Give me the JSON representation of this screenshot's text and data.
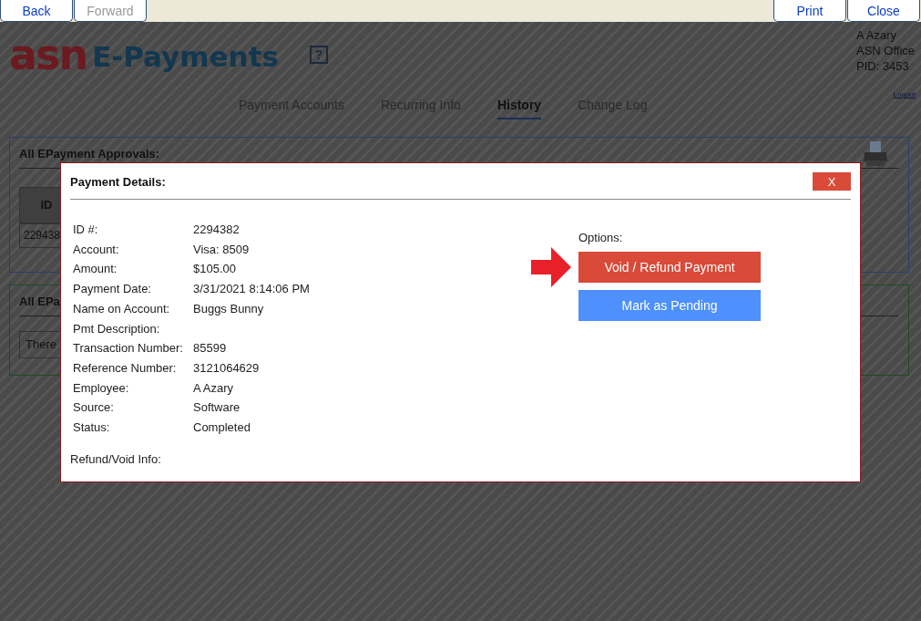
{
  "toolbar": {
    "left": [
      {
        "label": "Back",
        "disabled": false
      },
      {
        "label": "Forward",
        "disabled": true
      }
    ],
    "right": [
      {
        "label": "Print",
        "disabled": false
      },
      {
        "label": "Close",
        "disabled": false
      }
    ]
  },
  "header": {
    "logo_mark": "asn",
    "logo_text": "E-Payments",
    "help": "?",
    "user": [
      "A Azary",
      "ASN Office",
      "PID: 3453"
    ],
    "logout": "Logout"
  },
  "tabs": [
    {
      "label": "Payment Accounts",
      "selected": false
    },
    {
      "label": "Recurring Info",
      "selected": false
    },
    {
      "label": "History",
      "selected": true
    },
    {
      "label": "Change Log",
      "selected": false
    }
  ],
  "approvals_panel": {
    "title": "All EPayment Approvals:",
    "column": "ID",
    "cell": "229438"
  },
  "second_panel": {
    "title": "All EPa",
    "message": "There"
  },
  "dialog": {
    "title": "Payment Details:",
    "close": "X",
    "fields": [
      {
        "label": "ID #:",
        "value": "2294382"
      },
      {
        "label": "Account:",
        "value": "Visa: 8509"
      },
      {
        "label": "Amount:",
        "value": "$105.00"
      },
      {
        "label": "Payment Date:",
        "value": "3/31/2021 8:14:06 PM"
      },
      {
        "label": "Name on Account:",
        "value": "Buggs Bunny"
      },
      {
        "label": "Pmt Description:"
      },
      {
        "label": "Transaction Number:",
        "value": "85599"
      },
      {
        "label": "Reference Number:",
        "value": "3121064629"
      },
      {
        "label": "Employee:",
        "value": "A Azary"
      },
      {
        "label": "Source:",
        "value": "Software"
      },
      {
        "label": "Status:",
        "value": "Completed"
      }
    ],
    "refund_label": "Refund/Void Info:",
    "options_label": "Options:",
    "options": [
      {
        "label": "Void / Refund Payment",
        "kind": "danger",
        "highlighted": true
      },
      {
        "label": "Mark as Pending",
        "kind": "primary",
        "highlighted": false
      }
    ]
  }
}
